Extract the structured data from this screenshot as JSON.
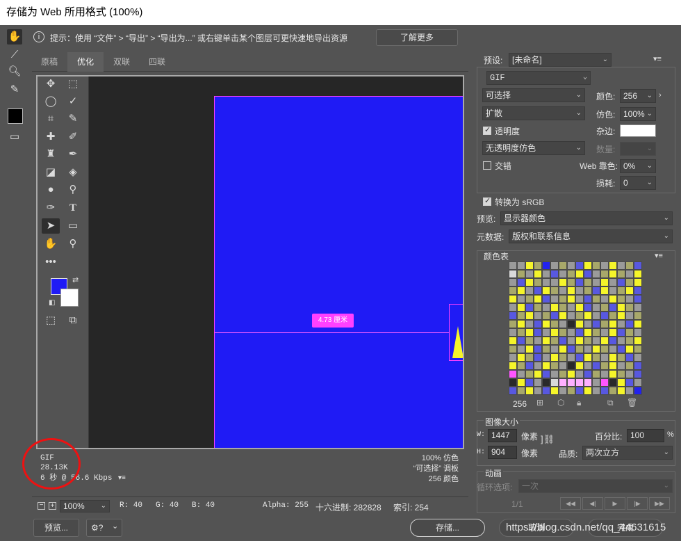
{
  "window": {
    "title": "存储为 Web 所用格式 (100%)"
  },
  "hint": {
    "text": "提示：使用 “文件” > “导出” > “导出为...” 或右键单击某个图层可更快速地导出资源",
    "learn_more": "了解更多"
  },
  "tabs": [
    "原稿",
    "优化",
    "双联",
    "四联"
  ],
  "canvas": {
    "measure_label": "4.73 厘米",
    "colors": {
      "canvas_bg": "#262626",
      "image_fill": "#1f1bf5",
      "guide": "#ff40ff"
    }
  },
  "canvas_info": {
    "format": "GIF",
    "size": "28.13K",
    "time": "6 秒 @ 56.6 Kbps",
    "right_lines": [
      "100% 仿色",
      "“可选择” 调板",
      "256 颜色"
    ]
  },
  "statusbar": {
    "zoom": "100%",
    "r": "R: 40",
    "g": "G: 40",
    "b": "B: 40",
    "alpha": "Alpha: 255",
    "hex": "十六进制: 282828",
    "index": "索引: 254"
  },
  "bottom": {
    "preview": "预览...",
    "save": "存储...",
    "cancel": "取消",
    "done": "完成"
  },
  "watermark": "https://blog.csdn.net/qq_44631615",
  "settings": {
    "preset_label": "预设:",
    "preset_value": "[未命名]",
    "format": "GIF",
    "palette": "可选择",
    "dither": "扩散",
    "transparency_label": "透明度",
    "transparency_dither": "无透明度仿色",
    "interlace_label": "交错",
    "colors_label": "颜色:",
    "colors_value": "256",
    "dither_amount_label": "仿色:",
    "dither_amount_value": "100%",
    "matte_label": "杂边:",
    "amount_label": "数量:",
    "web_snap_label": "Web 靠色:",
    "web_snap_value": "0%",
    "lossy_label": "损耗:",
    "lossy_value": "0",
    "convert_srgb": "转换为 sRGB",
    "preview_label": "预览:",
    "preview_value": "显示器颜色",
    "metadata_label": "元数据:",
    "metadata_value": "版权和联系信息"
  },
  "color_table": {
    "title": "颜色表",
    "count": "256",
    "palette": {
      "Y": "#f5f52a",
      "K": "#a8a86a",
      "B": "#5858e0",
      "G": "#9a9a9a",
      "D": "#2a2a2a",
      "P": "#ff55ff",
      "L": "#ffb0ff",
      "U": "#2222ee",
      "W": "#d9d9d9"
    },
    "rows": [
      "GGYKUGKGBYKGYGKB",
      "WKGYGBGKYBGKYKGY",
      "GBYKGGYKBKGYGBKY",
      "KYGBYKGYGKBYGKYB",
      "YGKYBGKYGBKGYKGB",
      "GYBKGYKGYBGKBYKG",
      "BKYGKBYGKYGBKYGK",
      "KYGBYKGDYGBKYGBY",
      "GKYBGYKGBYKGYBKG",
      "YBKGYKBGYKGYBGKY",
      "KGYBKGYBKGYKGBYK",
      "GYKBGYKGBYKGYKBG",
      "YKBGYKGDYGBKYGKB",
      "PGKYBGKYGBKGYKGB",
      "DYBGDWLLLLGPDYBG",
      "BKYGBYGKBYGBKYGU"
    ]
  },
  "image_size": {
    "title": "图像大小",
    "w_label": "W:",
    "w_value": "1447",
    "h_label": "H:",
    "h_value": "904",
    "unit": "像素",
    "percent_label": "百分比:",
    "percent_value": "100",
    "percent_unit": "%",
    "quality_label": "品质:",
    "quality_value": "两次立方"
  },
  "animation": {
    "title": "动画",
    "loop_label": "循环选项:",
    "loop_value": "一次",
    "frame": "1/1"
  }
}
